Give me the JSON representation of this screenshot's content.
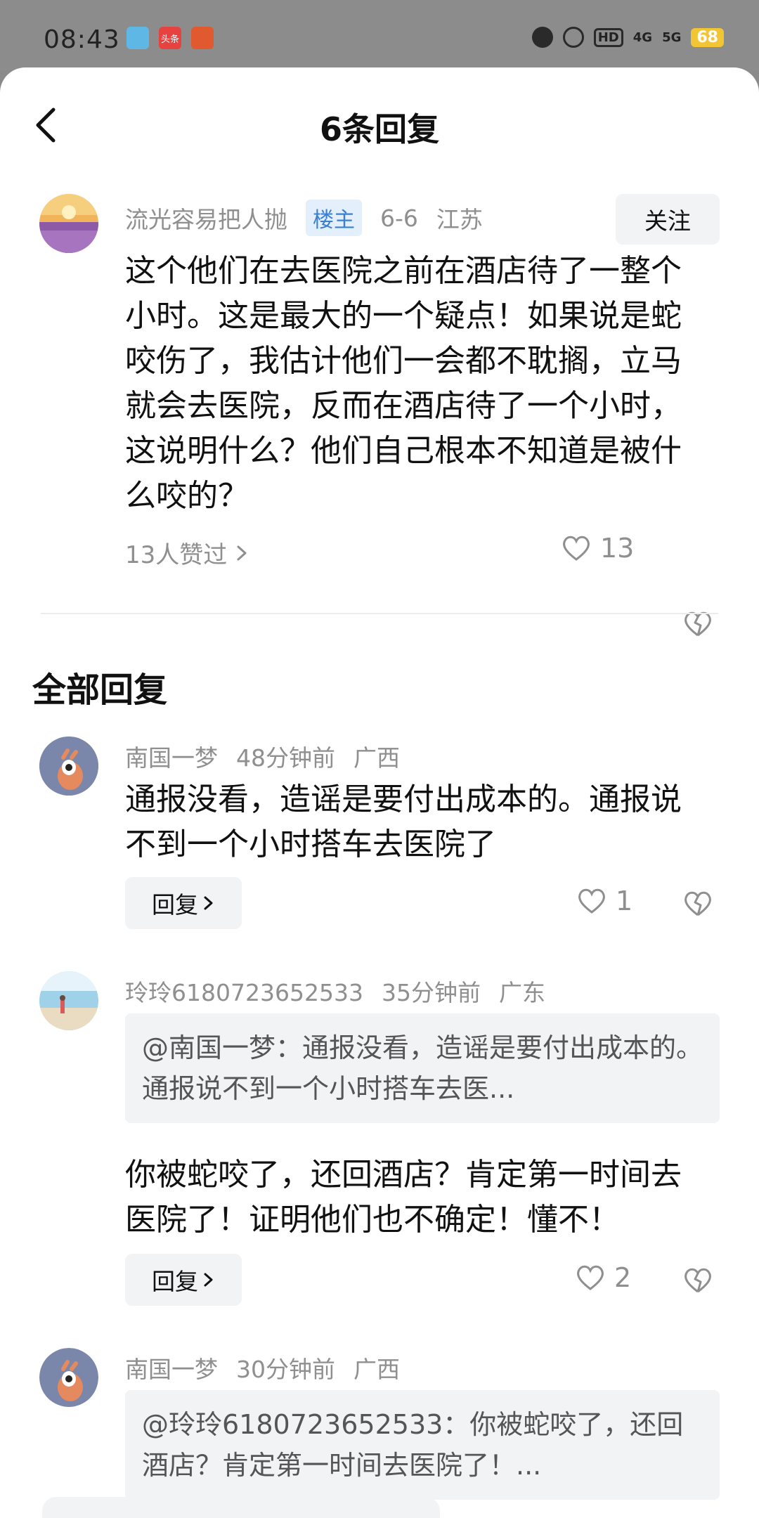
{
  "status_bar": {
    "time": "08:43",
    "apps": [
      {
        "name": "phone-app-icon",
        "label": "",
        "color": "#5fb7e6"
      },
      {
        "name": "toutiao-app-icon",
        "label": "头条",
        "color": "#e64340"
      },
      {
        "name": "game-app-icon",
        "label": "",
        "color": "#e0592f"
      }
    ],
    "hd": "HD",
    "network1": "4G",
    "network2": "5G",
    "battery": "68"
  },
  "header": {
    "title": "6条回复"
  },
  "main_comment": {
    "author": "流光容易把人抛",
    "badge": "楼主",
    "date": "6-6",
    "location": "江苏",
    "follow_label": "关注",
    "text": "这个他们在去医院之前在酒店待了一整个小时。这是最大的一个疑点！如果说是蛇咬伤了，我估计他们一会都不耽搁，立马就会去医院，反而在酒店待了一个小时，这说明什么？他们自己根本不知道是被什么咬的？",
    "liked_by": "13人赞过",
    "likes": "13"
  },
  "section_title": "全部回复",
  "replies": [
    {
      "author": "南国一梦",
      "time": "48分钟前",
      "location": "广西",
      "quote": "",
      "text": "通报没看，造谣是要付出成本的。通报说不到一个小时搭车去医院了",
      "reply_label": "回复",
      "likes": "1"
    },
    {
      "author": "玲玲6180723652533",
      "time": "35分钟前",
      "location": "广东",
      "quote": "@南国一梦：通报没看，造谣是要付出成本的。通报说不到一个小时搭车去医...",
      "text": "你被蛇咬了，还回酒店？肯定第一时间去医院了！证明他们也不确定！懂不！",
      "reply_label": "回复",
      "likes": "2"
    },
    {
      "author": "南国一梦",
      "time": "30分钟前",
      "location": "广西",
      "quote": "@玲玲6180723652533：你被蛇咬了，还回酒店？肯定第一时间去医院了！...",
      "text": "",
      "reply_label": "",
      "likes": ""
    }
  ],
  "colors": {
    "badge_bg": "#e3effb",
    "badge_text": "#3b7fd0",
    "muted": "#8f8f8f",
    "button_bg": "#f2f3f5"
  }
}
